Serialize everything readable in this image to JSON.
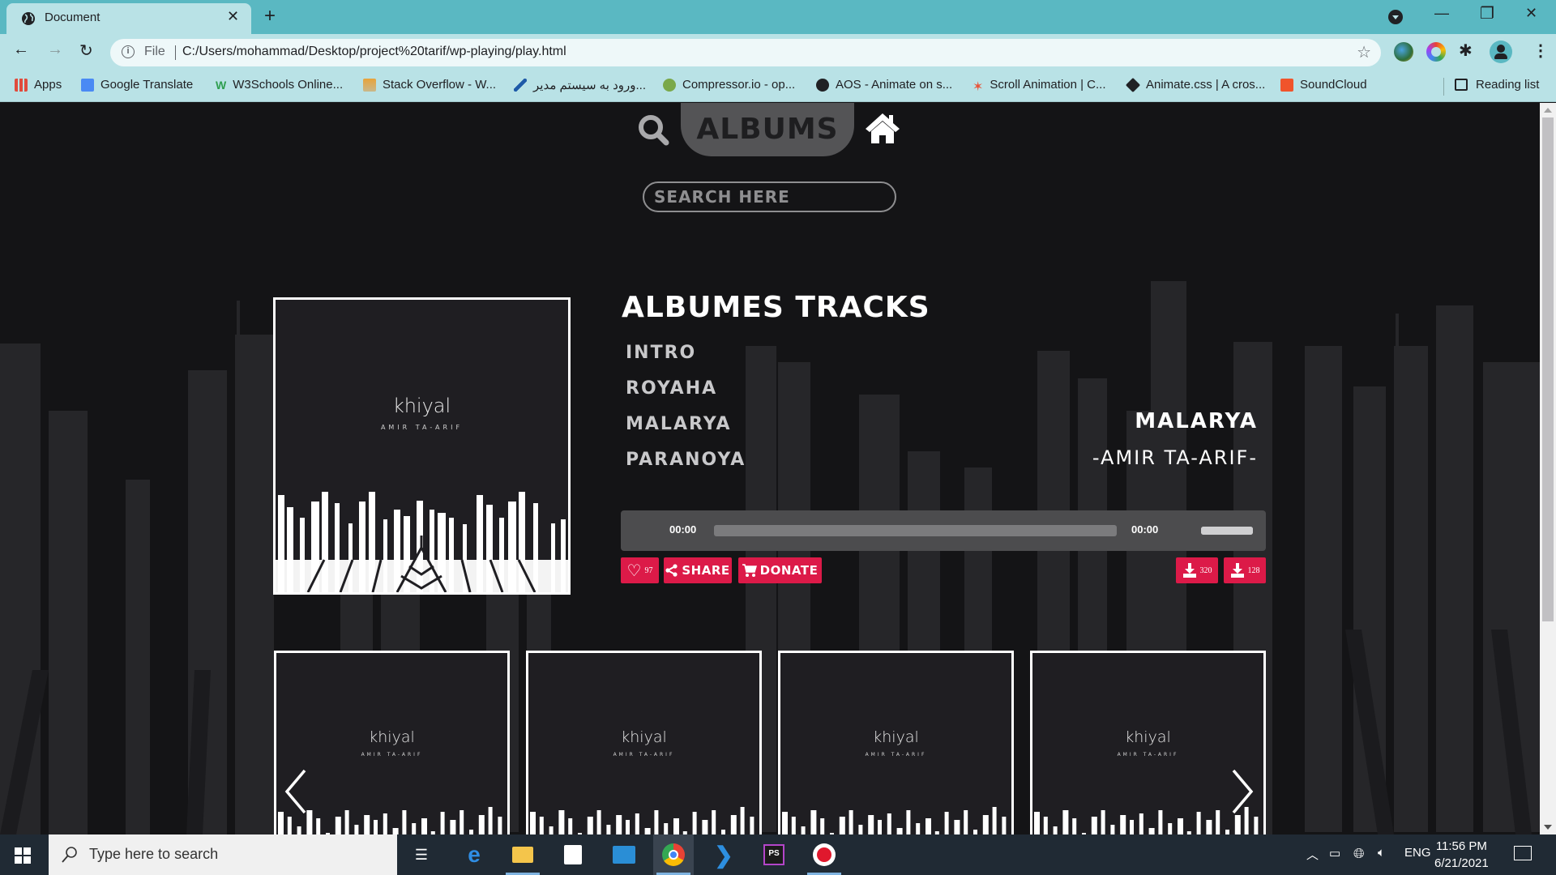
{
  "browser": {
    "tab_title": "Document",
    "url_scheme_label": "File",
    "url": "C:/Users/mohammad/Desktop/project%20tarif/wp-playing/play.html",
    "bookmarks": [
      {
        "label": "Apps",
        "icon": "apps-grid-icon",
        "color": "#e04b3c"
      },
      {
        "label": "Google Translate",
        "icon": "google-translate-icon",
        "color": "#4a8af4"
      },
      {
        "label": "W3Schools Online...",
        "icon": "w3schools-icon",
        "color": "#2e9e4f"
      },
      {
        "label": "Stack Overflow - W...",
        "icon": "stackoverflow-icon",
        "color": "#e8a33a"
      },
      {
        "label": "ورود به سیستم مدیر...",
        "icon": "admin-login-icon",
        "color": "#1e5aa8"
      },
      {
        "label": "Compressor.io - op...",
        "icon": "compressor-icon",
        "color": "#7aa84a"
      },
      {
        "label": "AOS - Animate on s...",
        "icon": "globe-icon",
        "color": "#202124"
      },
      {
        "label": "Scroll Animation | C...",
        "icon": "scroll-animation-icon",
        "color": "#e8553a"
      },
      {
        "label": "Animate.css | A cros...",
        "icon": "animatecss-icon",
        "color": "#202124"
      },
      {
        "label": "SoundCloud",
        "icon": "soundcloud-icon",
        "color": "#f0542b"
      }
    ],
    "reading_list": "Reading list"
  },
  "header": {
    "albums_label": "ALBUMS",
    "search_placeholder": "SEARCH HERE"
  },
  "album": {
    "cover_title": "khiyal",
    "cover_artist": "AMIR TA-ARIF",
    "tracks_heading": "ALBUMES TRACKS",
    "tracks": [
      "INTRO",
      "ROYAHA",
      "MALARYA",
      "PARANOYA"
    ]
  },
  "now_playing": {
    "title": "MALARYA",
    "artist": "-AMIR TA-ARIF-",
    "current_time": "00:00",
    "duration": "00:00",
    "progress_percent": 0,
    "volume_percent": 100
  },
  "actions": {
    "like_count": "97",
    "share_label": "SHARE",
    "donate_label": "DONATE",
    "download_320_count": "320",
    "download_128_count": "128",
    "accent_color": "#dc1a48"
  },
  "related_albums": [
    {
      "title": "khiyal",
      "artist": "AMIR TA-ARIF"
    },
    {
      "title": "khiyal",
      "artist": "AMIR TA-ARIF"
    },
    {
      "title": "khiyal",
      "artist": "AMIR TA-ARIF"
    },
    {
      "title": "khiyal",
      "artist": "AMIR TA-ARIF"
    }
  ],
  "taskbar": {
    "search_placeholder": "Type here to search",
    "apps": [
      "task-view",
      "edge",
      "file-explorer",
      "microsoft-store",
      "mail",
      "chrome",
      "vscode",
      "phpstorm",
      "screen-recorder"
    ],
    "language": "ENG",
    "time": "11:56 PM",
    "date": "6/21/2021"
  }
}
